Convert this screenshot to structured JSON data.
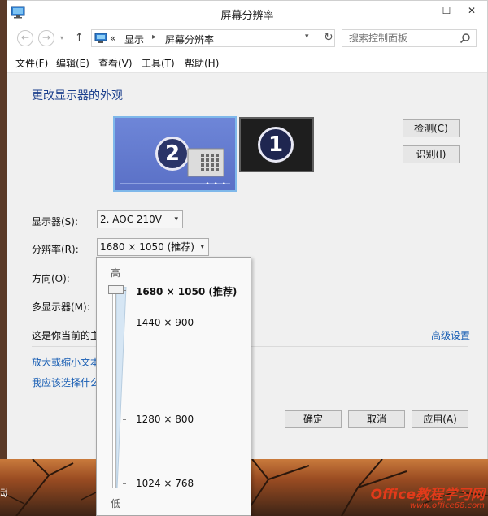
{
  "window": {
    "title": "屏幕分辨率",
    "min_glyph": "—",
    "max_glyph": "☐",
    "close_glyph": "✕"
  },
  "nav": {
    "back_glyph": "←",
    "forward_glyph": "→",
    "history_glyph": "▾",
    "up_glyph": "↑",
    "breadcrumb_prefix": "«",
    "breadcrumb": [
      "显示",
      "屏幕分辨率"
    ],
    "breadcrumb_sep": "▸",
    "dropdown_glyph": "▾",
    "refresh_glyph": "↻",
    "search_placeholder": "搜索控制面板"
  },
  "menubar": {
    "items": [
      "文件(F)",
      "编辑(E)",
      "查看(V)",
      "工具(T)",
      "帮助(H)"
    ]
  },
  "main": {
    "heading": "更改显示器的外观",
    "monitors": [
      {
        "number": "2",
        "selected": true
      },
      {
        "number": "1",
        "selected": false
      }
    ],
    "detect_label": "检测(C)",
    "identify_label": "识别(I)",
    "monitor_dots": "• • •",
    "display_label": "显示器(S):",
    "display_value": "2. AOC 210V",
    "resolution_label": "分辨率(R):",
    "resolution_value": "1680 × 1050 (推荐)",
    "orientation_label": "方向(O):",
    "multi_display_label": "多显示器(M):",
    "status_text_partial": "这是你当前的主",
    "advanced_link": "高级设置",
    "link_text_size": "放大或缩小文本",
    "link_which_settings": "我应该选择什么"
  },
  "footer": {
    "ok_label": "确定",
    "cancel_label": "取消",
    "apply_label": "应用(A)"
  },
  "resolution_popup": {
    "high_label": "高",
    "low_label": "低",
    "options": [
      {
        "label": "1680 × 1050 (推荐)",
        "selected": true
      },
      {
        "label": "1440 × 900",
        "selected": false
      },
      {
        "label": "1280 × 800",
        "selected": false
      },
      {
        "label": "1024 × 768",
        "selected": false
      }
    ]
  },
  "desktop": {
    "left_label": "动",
    "watermark_main": "Office教程学习网",
    "watermark_sub": "www.office68.com"
  },
  "colors": {
    "link": "#1a5fb4",
    "heading": "#1a3e8c",
    "monitor_selected": "#6e86d8",
    "monitor_other": "#1e1e1e",
    "watermark": "#e23a1a"
  }
}
